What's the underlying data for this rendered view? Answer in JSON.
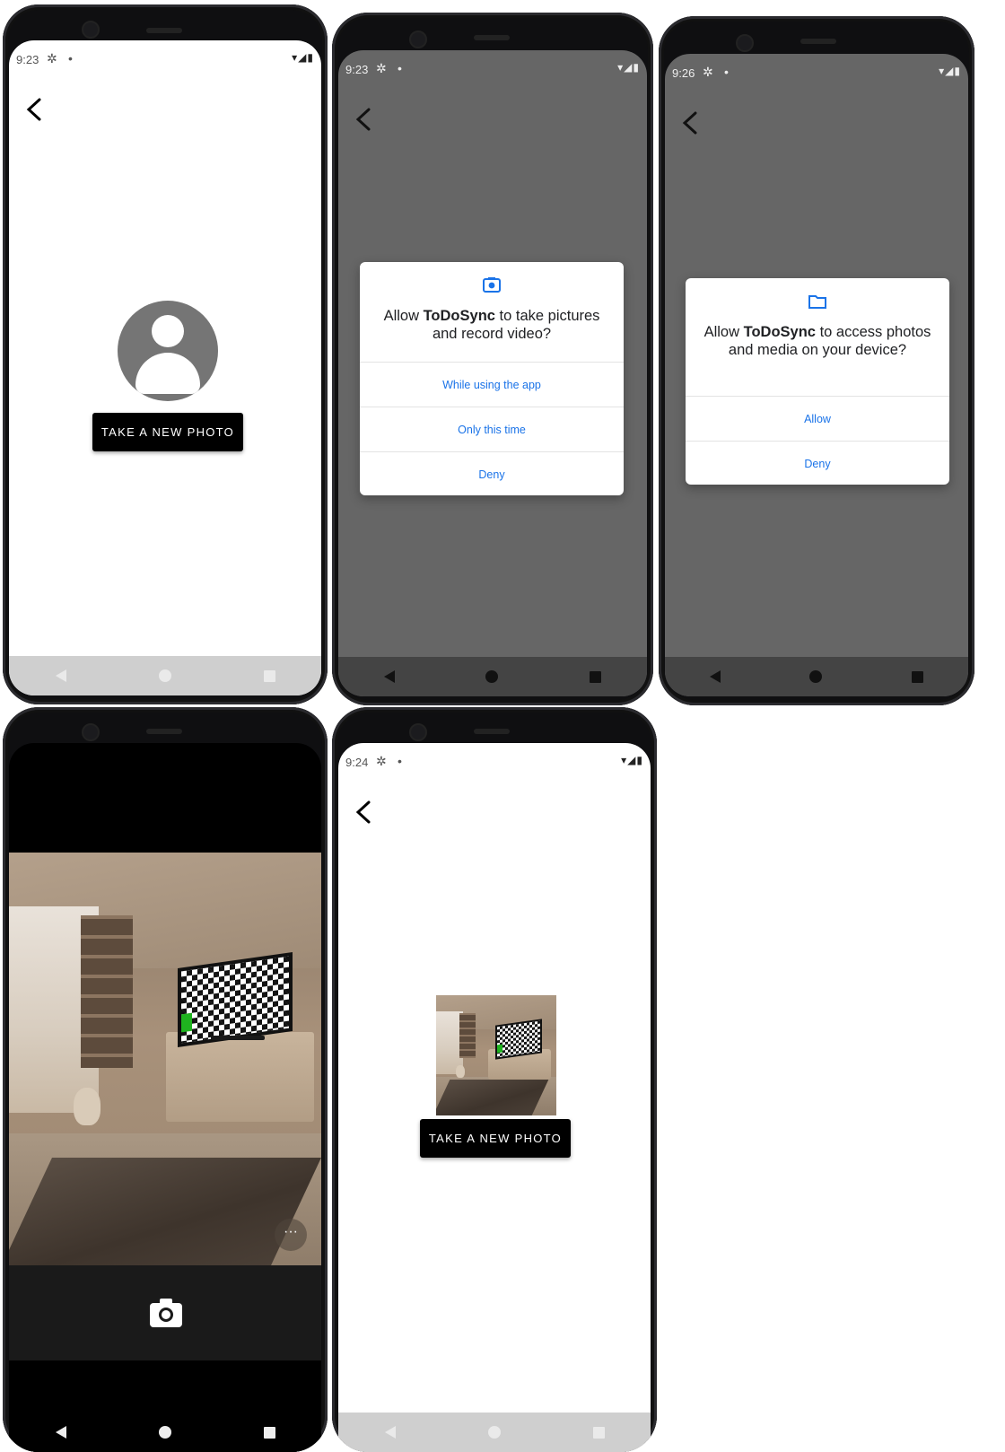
{
  "phones": {
    "p1": {
      "time": "9:23",
      "button": "TAKE A NEW PHOTO"
    },
    "p2": {
      "time": "9:23",
      "dialog": {
        "pre": "Allow ",
        "app": "ToDoSync",
        "post": " to take pictures and record video?",
        "options": [
          "While using the app",
          "Only this time",
          "Deny"
        ]
      }
    },
    "p3": {
      "time": "9:26",
      "dialog": {
        "pre": "Allow ",
        "app": "ToDoSync",
        "post": " to access photos and media on your device?",
        "options": [
          "Allow",
          "Deny"
        ]
      }
    },
    "p4": {
      "more": "···"
    },
    "p5": {
      "time": "9:24",
      "button": "TAKE A NEW PHOTO"
    }
  },
  "icons": {
    "gear": "✲",
    "dot": "•",
    "signal": "▾◢▮"
  },
  "colors": {
    "dim_overlay": "#666666",
    "dialog_accent": "#1a73e8",
    "button_bg": "#000000",
    "avatar_gray": "#757575"
  }
}
